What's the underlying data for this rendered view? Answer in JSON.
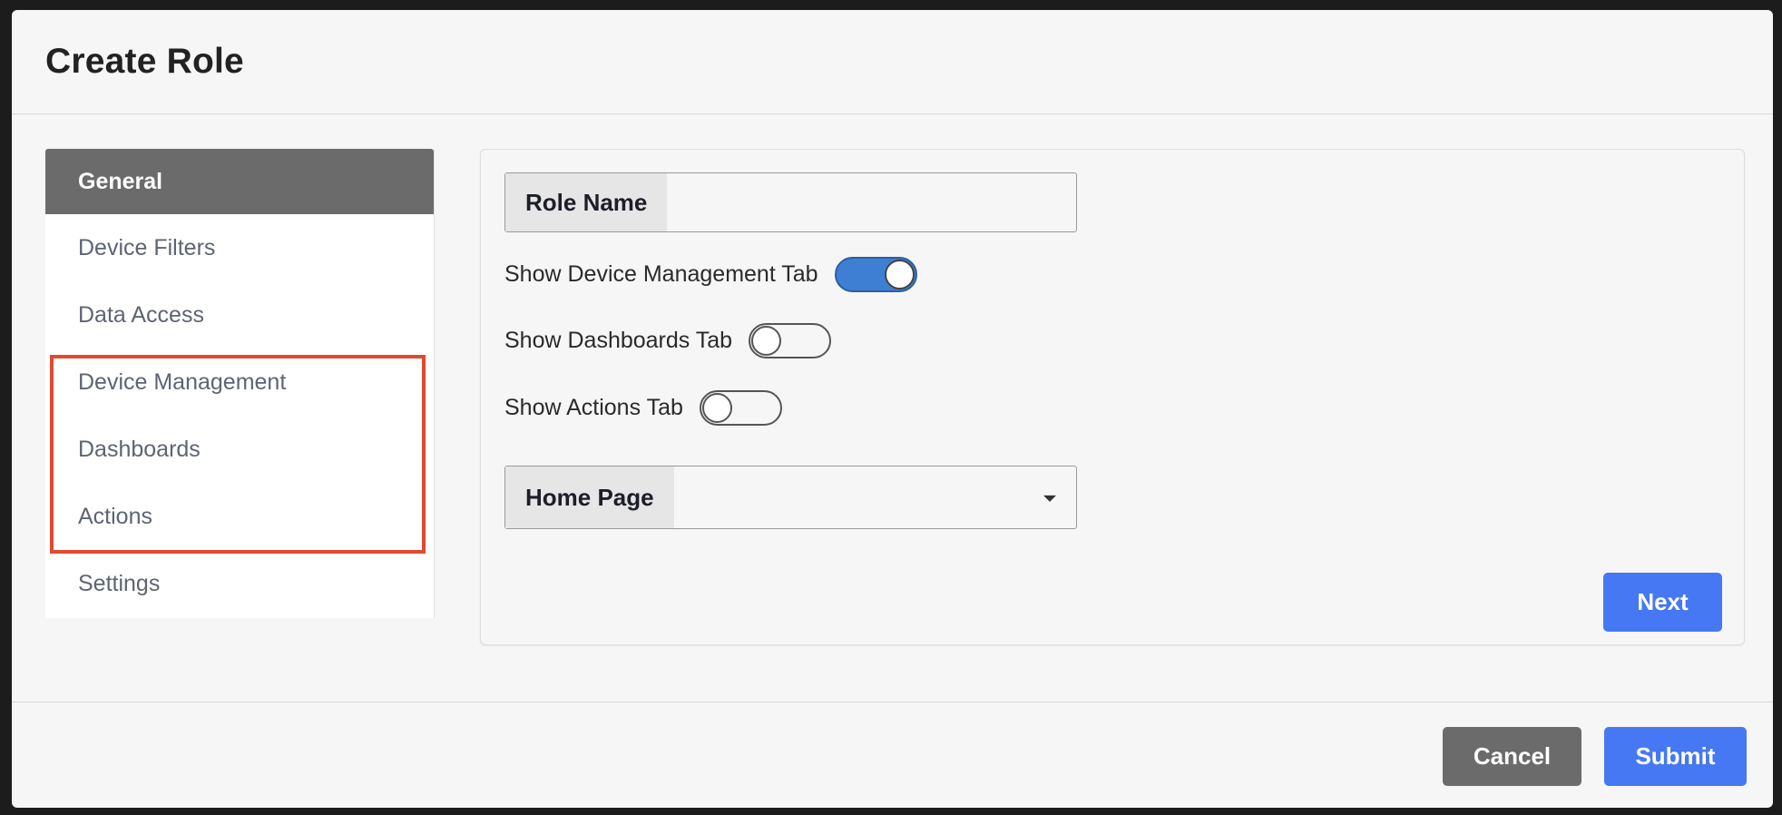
{
  "dialog": {
    "title": "Create Role"
  },
  "sidebar": {
    "items": [
      {
        "label": "General",
        "active": true
      },
      {
        "label": "Device Filters",
        "active": false
      },
      {
        "label": "Data Access",
        "active": false
      },
      {
        "label": "Device Management",
        "active": false
      },
      {
        "label": "Dashboards",
        "active": false
      },
      {
        "label": "Actions",
        "active": false
      },
      {
        "label": "Settings",
        "active": false
      }
    ],
    "highlight_color": "#e04a2f"
  },
  "form": {
    "role_name": {
      "label": "Role Name",
      "value": ""
    },
    "toggles": [
      {
        "label": "Show Device Management Tab",
        "on": true
      },
      {
        "label": "Show Dashboards Tab",
        "on": false
      },
      {
        "label": "Show Actions Tab",
        "on": false
      }
    ],
    "home_page": {
      "label": "Home Page",
      "selected": "",
      "icon": "caret-down-icon"
    },
    "next_label": "Next"
  },
  "footer": {
    "cancel_label": "Cancel",
    "submit_label": "Submit"
  },
  "colors": {
    "primary": "#4578f2",
    "toggle_on": "#3f7fd3",
    "secondary": "#6b6b6b",
    "active_nav": "#6b6b6b"
  }
}
